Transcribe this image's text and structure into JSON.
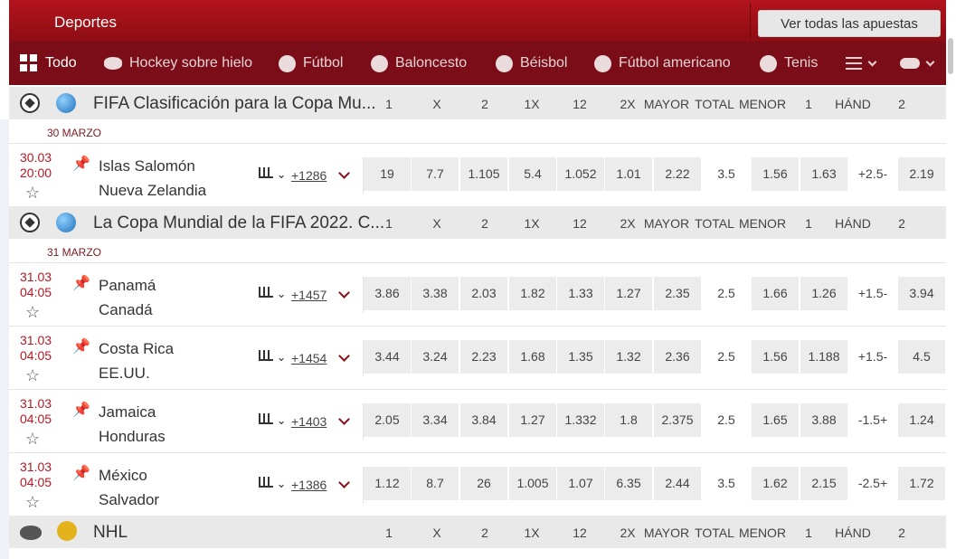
{
  "header": {
    "title": "Deportes",
    "view_all": "Ver todas las apuestas"
  },
  "nav": {
    "items": [
      {
        "label": "Todo",
        "icon": "grid-icon",
        "active": true
      },
      {
        "label": "Hockey sobre hielo",
        "icon": "puck-icon"
      },
      {
        "label": "Fútbol",
        "icon": "soccer-ball-icon"
      },
      {
        "label": "Baloncesto",
        "icon": "basketball-icon"
      },
      {
        "label": "Béisbol",
        "icon": "baseball-icon"
      },
      {
        "label": "Fútbol americano",
        "icon": "american-football-icon"
      },
      {
        "label": "Tenis",
        "icon": "tennis-ball-icon"
      }
    ]
  },
  "columns": [
    "1",
    "X",
    "2",
    "1X",
    "12",
    "2X",
    "MAYOR",
    "TOTAL",
    "MENOR",
    "1",
    "HÁND",
    "2"
  ],
  "leagues": [
    {
      "name": "FIFA Clasificación para la Copa Mu...",
      "date_label": "30 MARZO",
      "matches": [
        {
          "date": "30.03",
          "time": "20:00",
          "home": "Islas Salomón",
          "away": "Nueva Zelandia",
          "more": "+1286",
          "odds": [
            "19",
            "7.7",
            "1.105",
            "5.4",
            "1.052",
            "1.01",
            "2.22",
            "3.5",
            "1.56",
            "1.63",
            "+2.5-",
            "2.19"
          ]
        }
      ]
    },
    {
      "name": "La Copa Mundial de la FIFA 2022. C...",
      "date_label": "31 MARZO",
      "matches": [
        {
          "date": "31.03",
          "time": "04:05",
          "home": "Panamá",
          "away": "Canadá",
          "more": "+1457",
          "odds": [
            "3.86",
            "3.38",
            "2.03",
            "1.82",
            "1.33",
            "1.27",
            "2.35",
            "2.5",
            "1.66",
            "1.26",
            "+1.5-",
            "3.94"
          ]
        },
        {
          "date": "31.03",
          "time": "04:05",
          "home": "Costa Rica",
          "away": "EE.UU.",
          "more": "+1454",
          "odds": [
            "3.44",
            "3.24",
            "2.23",
            "1.68",
            "1.35",
            "1.32",
            "2.36",
            "2.5",
            "1.56",
            "1.188",
            "+1.5-",
            "4.5"
          ]
        },
        {
          "date": "31.03",
          "time": "04:05",
          "home": "Jamaica",
          "away": "Honduras",
          "more": "+1403",
          "odds": [
            "2.05",
            "3.34",
            "3.84",
            "1.27",
            "1.332",
            "1.8",
            "2.375",
            "2.5",
            "1.65",
            "3.88",
            "-1.5+",
            "1.24"
          ]
        },
        {
          "date": "31.03",
          "time": "04:05",
          "home": "México",
          "away": "Salvador",
          "more": "+1386",
          "odds": [
            "1.12",
            "8.7",
            "26",
            "1.005",
            "1.07",
            "6.35",
            "2.44",
            "3.5",
            "1.62",
            "2.15",
            "-2.5+",
            "1.72"
          ]
        }
      ]
    },
    {
      "name": "NHL",
      "matches": []
    }
  ],
  "colors": {
    "header": "#a5111a",
    "nav": "#7a0d17",
    "date_text": "#b51822"
  }
}
